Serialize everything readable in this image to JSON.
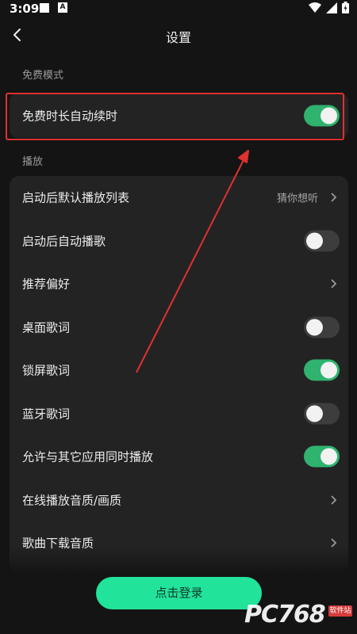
{
  "status_bar": {
    "time": "3:09"
  },
  "header": {
    "title": "设置"
  },
  "free_mode": {
    "section_label": "免费模式",
    "row": {
      "label": "免费时长自动续时",
      "toggle_on": true
    }
  },
  "playback": {
    "section_label": "播放",
    "rows": [
      {
        "label": "启动后默认播放列表",
        "value": "猜你想听",
        "control": "chevron"
      },
      {
        "label": "启动后自动播歌",
        "control": "toggle",
        "toggle_on": false
      },
      {
        "label": "推荐偏好",
        "control": "chevron"
      },
      {
        "label": "桌面歌词",
        "control": "toggle",
        "toggle_on": false
      },
      {
        "label": "锁屏歌词",
        "control": "toggle",
        "toggle_on": true
      },
      {
        "label": "蓝牙歌词",
        "control": "toggle",
        "toggle_on": false
      },
      {
        "label": "允许与其它应用同时播放",
        "control": "toggle",
        "toggle_on": true
      },
      {
        "label": "在线播放音质/画质",
        "control": "chevron"
      },
      {
        "label": "歌曲下载音质",
        "control": "chevron"
      }
    ]
  },
  "login_button": {
    "label": "点击登录"
  },
  "watermark": {
    "text": "PC768",
    "badge": "软件站"
  },
  "colors": {
    "background": "#141414",
    "card": "#232323",
    "toggle_on": "#2fb36f",
    "toggle_off": "#3d3d3d",
    "login_button": "#22e39a",
    "highlight_border": "#e03131",
    "annotation_arrow": "#e03131"
  },
  "icons": {
    "back": "chevron-left-icon",
    "row_arrow": "chevron-right-icon",
    "wifi": "wifi-icon",
    "signal": "signal-icon",
    "battery": "battery-icon"
  }
}
